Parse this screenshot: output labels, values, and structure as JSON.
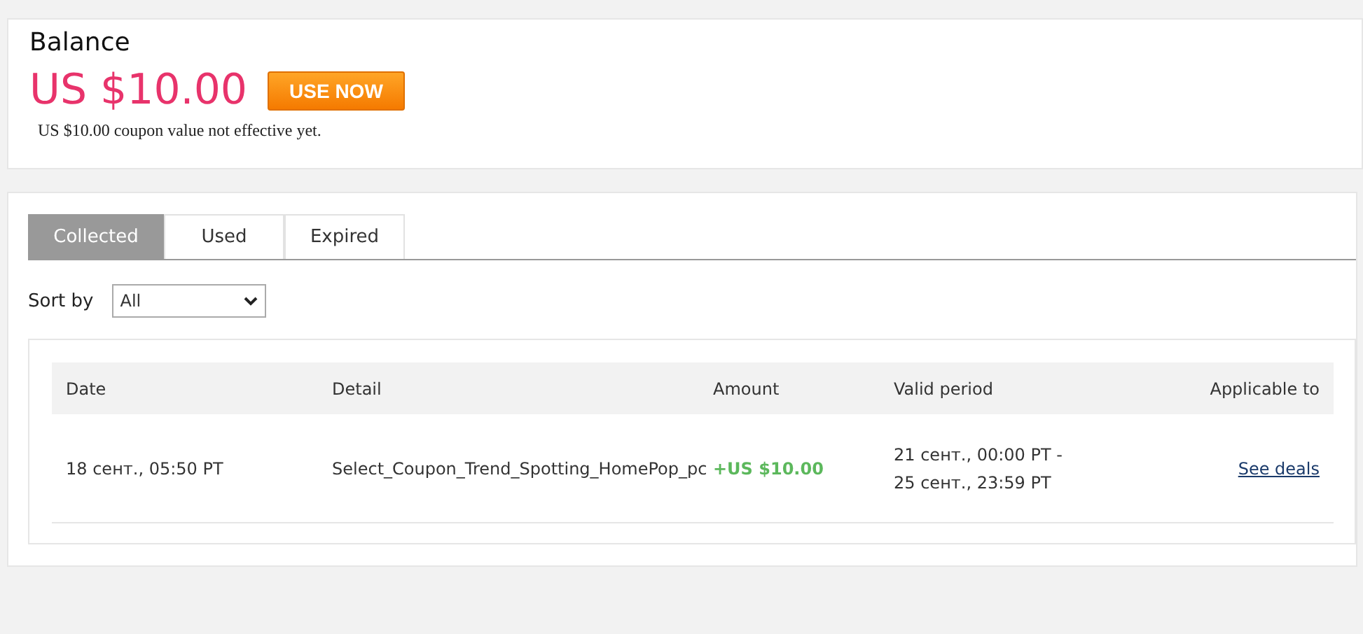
{
  "balance": {
    "title": "Balance",
    "amount": "US $10.00",
    "button": "USE NOW",
    "note": "US $10.00 coupon value not effective yet."
  },
  "tabs": [
    {
      "label": "Collected",
      "selected": true
    },
    {
      "label": "Used",
      "selected": false
    },
    {
      "label": "Expired",
      "selected": false
    }
  ],
  "sort": {
    "label": "Sort by",
    "value": "All"
  },
  "table": {
    "columns": [
      "Date",
      "Detail",
      "Amount",
      "Valid period",
      "Applicable to"
    ],
    "rows": [
      {
        "date": "18 сент., 05:50 PT",
        "detail": "Select_Coupon_Trend_Spotting_HomePop_pc",
        "amount": "+US $10.00",
        "valid_period": "21 сент., 00:00 PT -\n25 сент., 23:59 PT",
        "link": "See deals"
      }
    ]
  }
}
